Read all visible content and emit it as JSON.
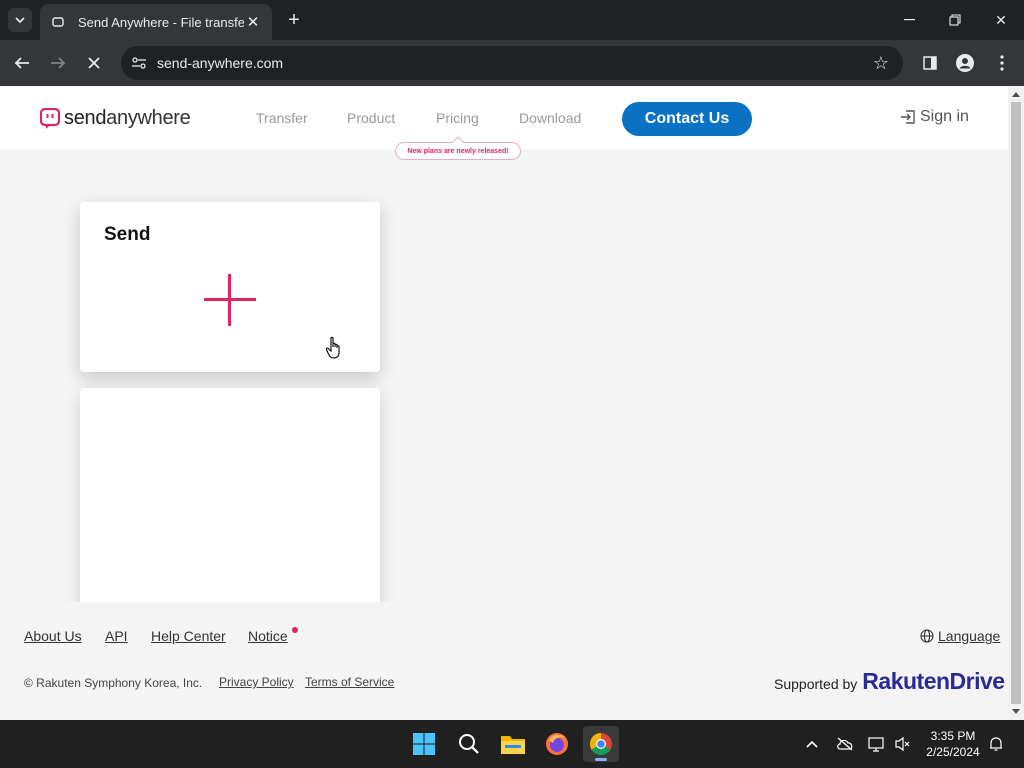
{
  "browser": {
    "tab_title": "Send Anywhere - File transfer",
    "url": "send-anywhere.com"
  },
  "site": {
    "logo_bold": "send",
    "logo_light": "anywhere",
    "nav": [
      "Transfer",
      "Product",
      "Pricing",
      "Download"
    ],
    "pricing_badge": "New plans are newly released!",
    "contact_label": "Contact Us",
    "signin_label": "Sign in"
  },
  "send_card": {
    "title": "Send"
  },
  "footer": {
    "links": [
      "About Us",
      "API",
      "Help Center",
      "Notice"
    ],
    "language_label": "Language",
    "copyright": "© Rakuten Symphony Korea, Inc.",
    "privacy": "Privacy Policy",
    "terms": "Terms of Service",
    "supported_by": "Supported by",
    "brand_a": "Rakuten",
    "brand_b": "Drive"
  },
  "taskbar": {
    "time": "3:35 PM",
    "date": "2/25/2024"
  },
  "colors": {
    "accent_pink": "#e0245e",
    "contact_blue": "#0a72c4",
    "rakuten_navy": "#2a2a96"
  }
}
